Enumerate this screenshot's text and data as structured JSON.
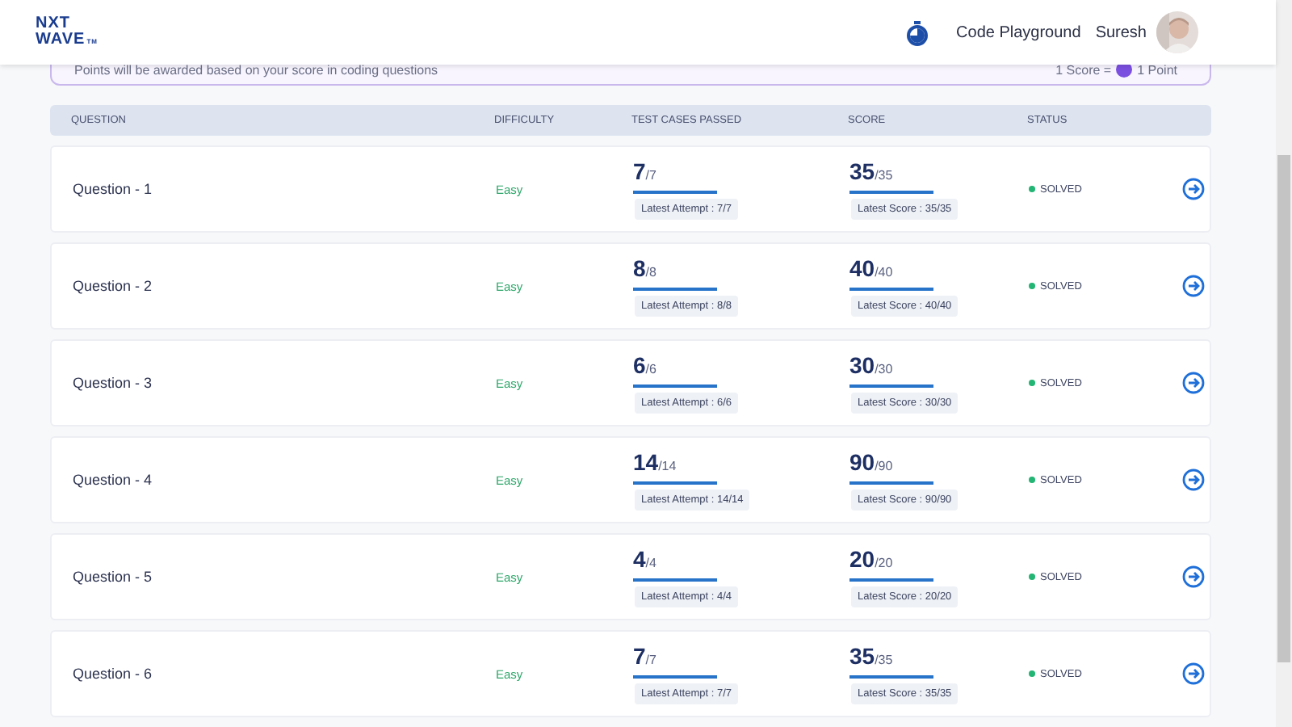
{
  "header": {
    "logo_lines": [
      "NXT",
      "WAVE"
    ],
    "logo_mark": "TM",
    "nav_link": "Code Playground",
    "user_name": "Suresh"
  },
  "banner": {
    "text": "Points will be awarded based on your score in coding questions",
    "rule_left": "1 Score =",
    "rule_right": "1 Point"
  },
  "table": {
    "columns": [
      "QUESTION",
      "DIFFICULTY",
      "TEST CASES PASSED",
      "SCORE",
      "STATUS"
    ],
    "rows": [
      {
        "question": "Question - 1",
        "difficulty": "Easy",
        "passed": {
          "value": "7",
          "total": "/7",
          "note": "Latest Attempt : 7/7"
        },
        "score": {
          "value": "35",
          "total": "/35",
          "note": "Latest Score : 35/35"
        },
        "status": {
          "label": "SOLVED",
          "color": "#22b573"
        }
      },
      {
        "question": "Question - 2",
        "difficulty": "Easy",
        "passed": {
          "value": "8",
          "total": "/8",
          "note": "Latest Attempt : 8/8"
        },
        "score": {
          "value": "40",
          "total": "/40",
          "note": "Latest Score : 40/40"
        },
        "status": {
          "label": "SOLVED",
          "color": "#22b573"
        }
      },
      {
        "question": "Question - 3",
        "difficulty": "Easy",
        "passed": {
          "value": "6",
          "total": "/6",
          "note": "Latest Attempt : 6/6"
        },
        "score": {
          "value": "30",
          "total": "/30",
          "note": "Latest Score : 30/30"
        },
        "status": {
          "label": "SOLVED",
          "color": "#22b573"
        }
      },
      {
        "question": "Question - 4",
        "difficulty": "Easy",
        "passed": {
          "value": "14",
          "total": "/14",
          "note": "Latest Attempt : 14/14"
        },
        "score": {
          "value": "90",
          "total": "/90",
          "note": "Latest Score : 90/90"
        },
        "status": {
          "label": "SOLVED",
          "color": "#22b573"
        }
      },
      {
        "question": "Question - 5",
        "difficulty": "Easy",
        "passed": {
          "value": "4",
          "total": "/4",
          "note": "Latest Attempt : 4/4"
        },
        "score": {
          "value": "20",
          "total": "/20",
          "note": "Latest Score : 20/20"
        },
        "status": {
          "label": "SOLVED",
          "color": "#22b573"
        }
      },
      {
        "question": "Question - 6",
        "difficulty": "Easy",
        "passed": {
          "value": "7",
          "total": "/7",
          "note": "Latest Attempt : 7/7"
        },
        "score": {
          "value": "35",
          "total": "/35",
          "note": "Latest Score : 35/35"
        },
        "status": {
          "label": "SOLVED",
          "color": "#22b573"
        }
      }
    ]
  }
}
